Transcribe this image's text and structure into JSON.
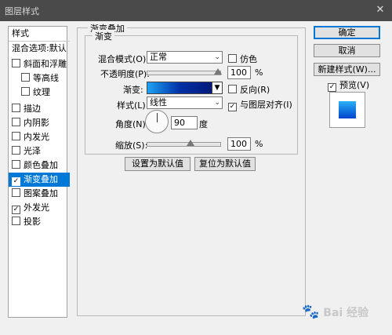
{
  "window": {
    "title": "图层样式",
    "close_glyph": "✕"
  },
  "stylelist": {
    "header": "样式",
    "blend_options": "混合选项:默认",
    "items": [
      {
        "label": "斜面和浮雕",
        "checked": false,
        "indent": false
      },
      {
        "label": "等高线",
        "checked": false,
        "indent": true
      },
      {
        "label": "纹理",
        "checked": false,
        "indent": true
      },
      {
        "label": "描边",
        "checked": false,
        "indent": false
      },
      {
        "label": "内阴影",
        "checked": false,
        "indent": false
      },
      {
        "label": "内发光",
        "checked": false,
        "indent": false
      },
      {
        "label": "光泽",
        "checked": false,
        "indent": false
      },
      {
        "label": "颜色叠加",
        "checked": false,
        "indent": false
      },
      {
        "label": "渐变叠加",
        "checked": true,
        "indent": false,
        "selected": true
      },
      {
        "label": "图案叠加",
        "checked": false,
        "indent": false
      },
      {
        "label": "外发光",
        "checked": true,
        "indent": false
      },
      {
        "label": "投影",
        "checked": false,
        "indent": false
      }
    ]
  },
  "panel": {
    "title": "渐变叠加",
    "subgroup": "渐变",
    "blend_mode_label": "混合模式(O):",
    "blend_mode_value": "正常",
    "dither_label": "仿色",
    "opacity_label": "不透明度(P):",
    "opacity_value": "100",
    "percent": "%",
    "gradient_label": "渐变:",
    "reverse_label": "反向(R)",
    "style_label": "样式(L):",
    "style_value": "线性",
    "align_label": "与图层对齐(I)",
    "angle_label": "角度(N):",
    "angle_value": "90",
    "angle_unit": "度",
    "scale_label": "缩放(S):",
    "scale_value": "100",
    "set_default": "设置为默认值",
    "reset_default": "复位为默认值"
  },
  "buttons": {
    "ok": "确定",
    "cancel": "取消",
    "new_style": "新建样式(W)...",
    "preview_label": "预览(V)"
  },
  "watermark": "Bai 经验",
  "colors": {
    "selection": "#0078d7",
    "titlebar": "#4a4a4a",
    "gradient_start": "#1da3f3",
    "gradient_end": "#001a78"
  }
}
